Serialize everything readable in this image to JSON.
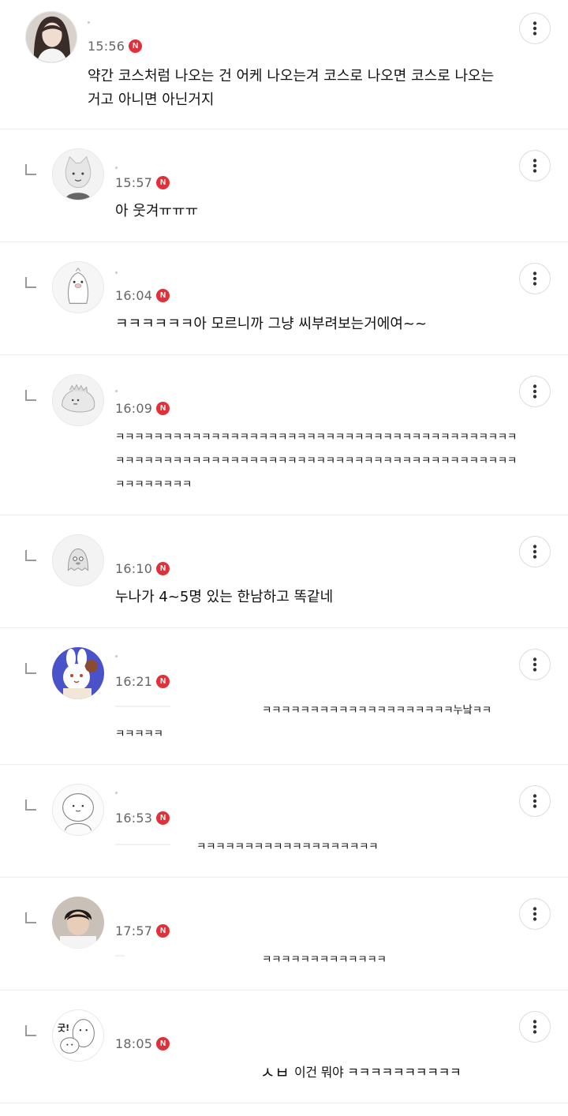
{
  "comments": [
    {
      "avatar": "profile-photo-woman",
      "time": "15:56",
      "badge": "N",
      "is_reply": false,
      "text": "약간 코스처럼 나오는 건 어케 나오는겨 코스로 나오면 코스로 나오는\n거고 아니면 아닌거지"
    },
    {
      "avatar": "cat-character",
      "time": "15:57",
      "badge": "N",
      "is_reply": true,
      "text": "아 웃겨ㅠㅠㅠ"
    },
    {
      "avatar": "penguin-character",
      "time": "16:04",
      "badge": "N",
      "is_reply": true,
      "text": "ㅋㅋㅋㅋㅋㅋ아 모르니까 그냥 씨부려보는거에여~~"
    },
    {
      "avatar": "dinosaur-character",
      "time": "16:09",
      "badge": "N",
      "is_reply": true,
      "text": "ㅋㅋㅋㅋㅋㅋㅋㅋㅋㅋㅋㅋㅋㅋㅋㅋㅋㅋㅋㅋㅋㅋㅋㅋㅋㅋㅋㅋㅋㅋㅋㅋㅋㅋㅋㅋㅋㅋㅋㅋㅋㅋㅋㅋㅋㅋㅋㅋㅋㅋㅋㅋㅋㅋㅋㅋㅋㅋㅋㅋㅋㅋㅋㅋㅋㅋㅋㅋㅋㅋㅋㅋㅋㅋㅋㅋㅋㅋㅋㅋㅋㅋㅋㅋㅋㅋㅋㅋㅋㅋㅋㅋ"
    },
    {
      "avatar": "ghost-character",
      "time": "16:10",
      "badge": "N",
      "is_reply": true,
      "text": "누나가 4~5명 있는 한남하고 똑같네"
    },
    {
      "avatar": "rabbit-character",
      "time": "16:21",
      "badge": "N",
      "is_reply": true,
      "text_line1": "ㅋㅋㅋㅋㅋㅋㅋㅋㅋㅋㅋㅋㅋㅋㅋㅋㅋㅋㅋㅋ누낰ㅋㅋ",
      "text_line2": "ㅋㅋㅋㅋㅋ"
    },
    {
      "avatar": "round-face-character",
      "time": "16:53",
      "badge": "N",
      "is_reply": true,
      "text": "ㅋㅋㅋㅋㅋㅋㅋㅋㅋㅋㅋㅋㅋㅋㅋㅋㅋㅋㅋ"
    },
    {
      "avatar": "profile-photo-man",
      "time": "17:57",
      "badge": "N",
      "is_reply": true,
      "text": "ㅋㅋㅋㅋㅋㅋㅋㅋㅋㅋㅋㅋㅋ"
    },
    {
      "avatar": "meme-character",
      "time": "18:05",
      "badge": "N",
      "is_reply": true,
      "text_prefix": "ㅅㅂ",
      "text": "이건 뭐야 ㅋㅋㅋㅋㅋㅋㅋㅋㅋㅋ"
    }
  ],
  "avatar_glyphs": {
    "rabbit_text": "",
    "meme_text": "굿!"
  },
  "colors": {
    "badge": "#e0313b",
    "divider": "#ececec",
    "time": "#666666"
  }
}
